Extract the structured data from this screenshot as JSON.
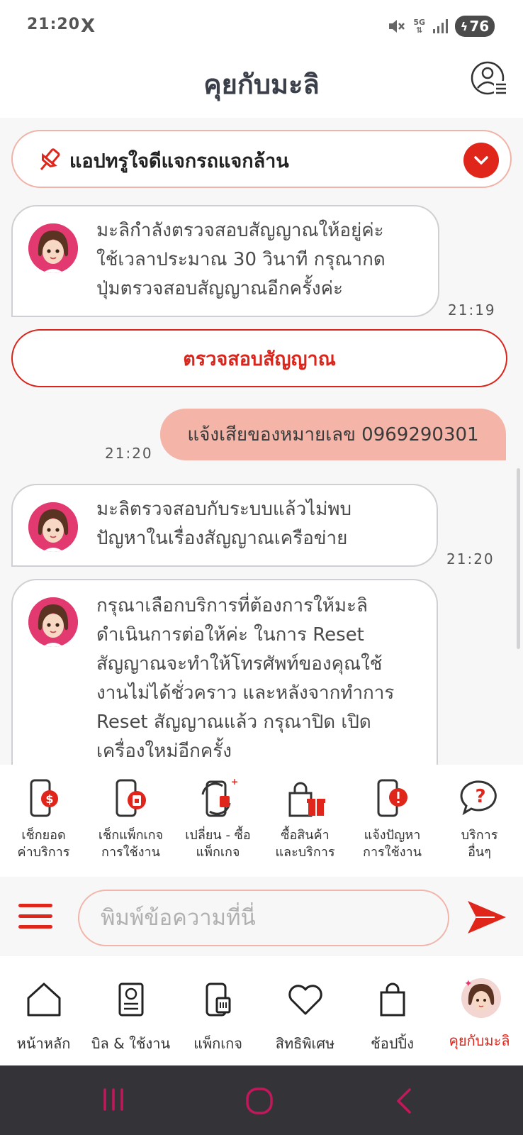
{
  "status": {
    "time": "21:20",
    "app_icon": "X",
    "network": "5G",
    "battery": "76"
  },
  "header": {
    "title": "คุยกับมะลิ"
  },
  "pinned": {
    "text": "แอปทรูใจดีแจกรถแจกล้าน"
  },
  "messages": {
    "bot1": {
      "text": "มะลิกำลังตรวจสอบสัญญาณให้อยู่ค่ะ\nใช้เวลาประมาณ 30 วินาที กรุณากด\nปุ่มตรวจสอบสัญญาณอีกครั้งค่ะ",
      "time": "21:19"
    },
    "check_button": "ตรวจสอบสัญญาณ",
    "user1": {
      "text": "แจ้งเสียของหมายเลข 0969290301",
      "time": "21:20"
    },
    "bot2": {
      "text": "มะลิตรวจสอบกับระบบแล้วไม่พบ\nปัญหาในเรื่องสัญญาณเครือข่าย",
      "time": "21:20"
    },
    "bot3": {
      "text": "กรุณาเลือกบริการที่ต้องการให้มะลิ\nดำเนินการต่อให้ค่ะ ในการ Reset\nสัญญาณจะทำให้โทรศัพท์ของคุณใช้\nงานไม่ได้ชั่วคราว และหลังจากทำการ\nReset สัญญาณแล้ว กรุณาปิด เปิด\nเครื่องใหม่อีกครั้ง"
    }
  },
  "quick_services": [
    {
      "label": "เช็กยอด\nค่าบริการ",
      "icon": "phone-dollar-icon"
    },
    {
      "label": "เช็กแพ็กเกจ\nการใช้งาน",
      "icon": "phone-sim-icon"
    },
    {
      "label": "เปลี่ยน - ซื้อ\nแพ็กเกจ",
      "icon": "phone-swap-icon"
    },
    {
      "label": "ซื้อสินค้า\nและบริการ",
      "icon": "shopping-gift-icon"
    },
    {
      "label": "แจ้งปัญหา\nการใช้งาน",
      "icon": "phone-alert-icon"
    },
    {
      "label": "บริการ\nอื่นๆ",
      "icon": "question-bubble-icon"
    }
  ],
  "input": {
    "placeholder": "พิมพ์ข้อความที่นี่"
  },
  "bottom_nav": [
    {
      "label": "หน้าหลัก",
      "icon": "home-icon"
    },
    {
      "label": "บิล & ใช้งาน",
      "icon": "bill-icon"
    },
    {
      "label": "แพ็กเกจ",
      "icon": "package-icon"
    },
    {
      "label": "สิทธิพิเศษ",
      "icon": "heart-icon"
    },
    {
      "label": "ช้อปปิ้ง",
      "icon": "shopping-bag-icon"
    },
    {
      "label": "คุยกับมะลิ",
      "icon": "mali-avatar-icon",
      "active": true
    }
  ],
  "colors": {
    "brand_red": "#e0251b",
    "user_bubble": "#f4b5a8",
    "pinned_border": "#f0b3a8"
  }
}
